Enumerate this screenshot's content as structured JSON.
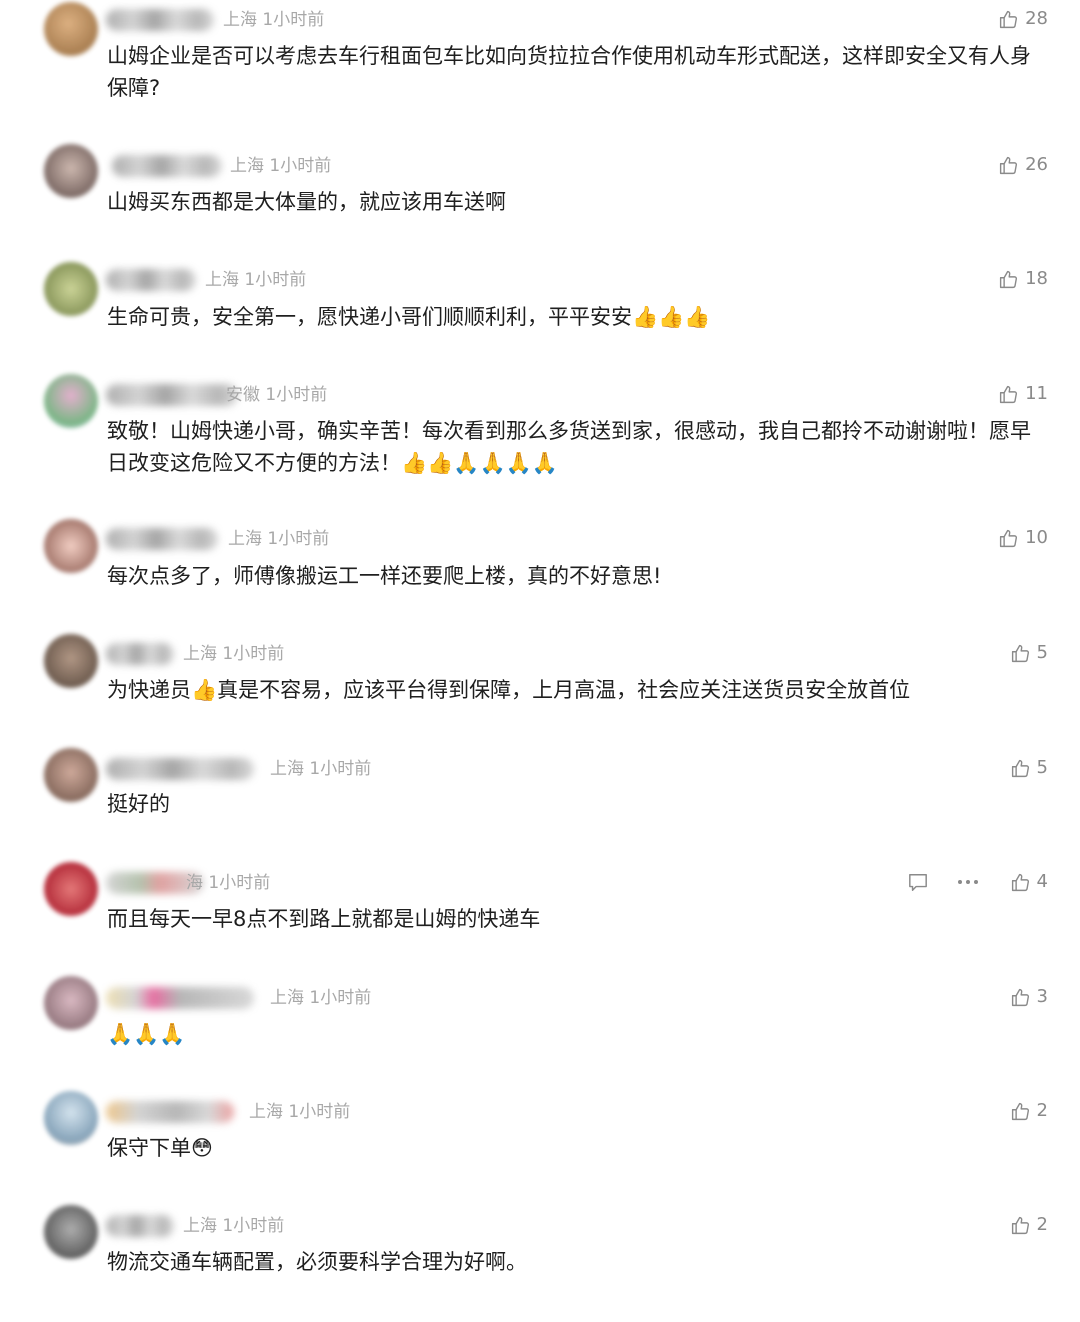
{
  "comments": [
    {
      "meta": "上海 1小时前",
      "text": "山姆企业是否可以考虑去车行租面包车比如向货拉拉合作使用机动车形式配送，这样即安全又有人身保障?",
      "likes": "28",
      "avatar_color": "#b98a5c"
    },
    {
      "meta": "上海 1小时前",
      "text": "山姆买东西都是大体量的，就应该用车送啊",
      "likes": "26",
      "avatar_color": "#8d7268"
    },
    {
      "meta": "上海 1小时前",
      "text": "生命可贵，安全第一，愿快递小哥们顺顺利利，平平安安👍👍👍",
      "likes": "18",
      "avatar_color": "#9aa566"
    },
    {
      "meta": "安徽 1小时前",
      "text": "致敬！山姆快递小哥，确实辛苦！每次看到那么多货送到家，很感动，我自己都拎不动谢谢啦！愿早日改变这危险又不方便的方法！👍👍🙏🙏🙏🙏",
      "likes": "11",
      "avatar_color": "#7fae8e"
    },
    {
      "meta": "上海 1小时前",
      "text": "每次点多了，师傅像搬运工一样还要爬上楼，真的不好意思!",
      "likes": "10",
      "avatar_color": "#c99a8a"
    },
    {
      "meta": "上海 1小时前",
      "text": "为快递员👍真是不容易，应该平台得到保障，上月高温，社会应关注送货员安全放首位",
      "likes": "5",
      "avatar_color": "#8a7a6a"
    },
    {
      "meta": "上海 1小时前",
      "text": "挺好的",
      "likes": "5",
      "avatar_color": "#9c8070"
    },
    {
      "meta": "海 1小时前",
      "text": "而且每天一早8点不到路上就都是山姆的快递车",
      "likes": "4",
      "avatar_color": "#c0303a"
    },
    {
      "meta": "上海 1小时前",
      "text": "🙏🙏🙏",
      "likes": "3",
      "avatar_color": "#a88890"
    },
    {
      "meta": "上海 1小时前",
      "text": "保守下单😳",
      "likes": "2",
      "avatar_color": "#9eb6c8"
    },
    {
      "meta": "上海 1小时前",
      "text": "物流交通车辆配置，必须要科学合理为好啊。",
      "likes": "2",
      "avatar_color": "#6f6f6f"
    }
  ],
  "icons": {
    "like": "thumbs-up-icon",
    "reply": "comment-icon",
    "more": "more-dots-icon"
  }
}
